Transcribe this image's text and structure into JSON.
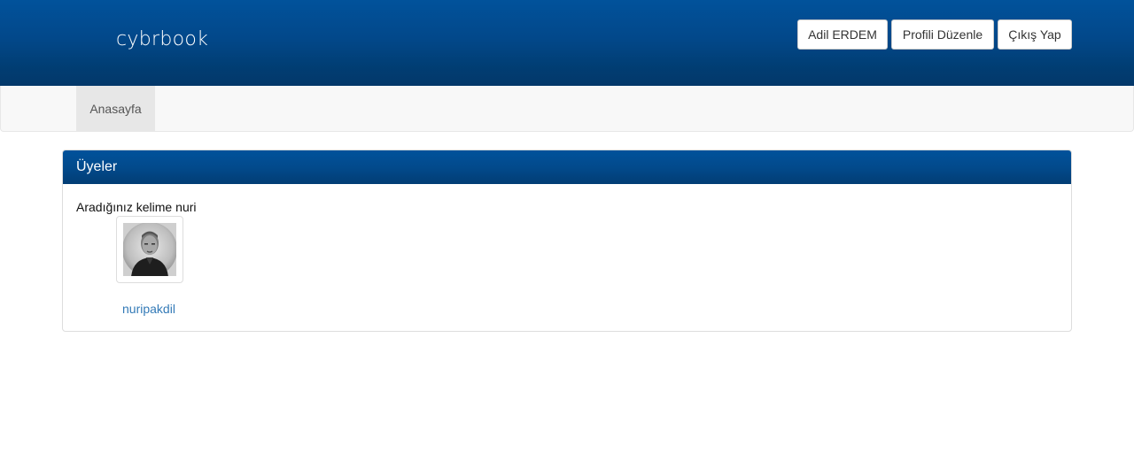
{
  "header": {
    "brand": "cybrbook",
    "buttons": {
      "user": "Adil ERDEM",
      "edit_profile": "Profili Düzenle",
      "logout": "Çıkış Yap"
    }
  },
  "nav": {
    "items": [
      {
        "label": "Anasayfa",
        "active": true
      }
    ]
  },
  "panel": {
    "title": "Üyeler",
    "search_label": "Aradığınız kelime",
    "search_keyword": "nuri",
    "members": [
      {
        "username": "nuripakdil",
        "avatar": "avatar-photo"
      }
    ]
  },
  "colors": {
    "header_top": "#01529b",
    "header_bottom": "#03386a",
    "link": "#337ab7",
    "nav_bg": "#f8f8f8",
    "nav_active_bg": "#e7e7e7"
  }
}
